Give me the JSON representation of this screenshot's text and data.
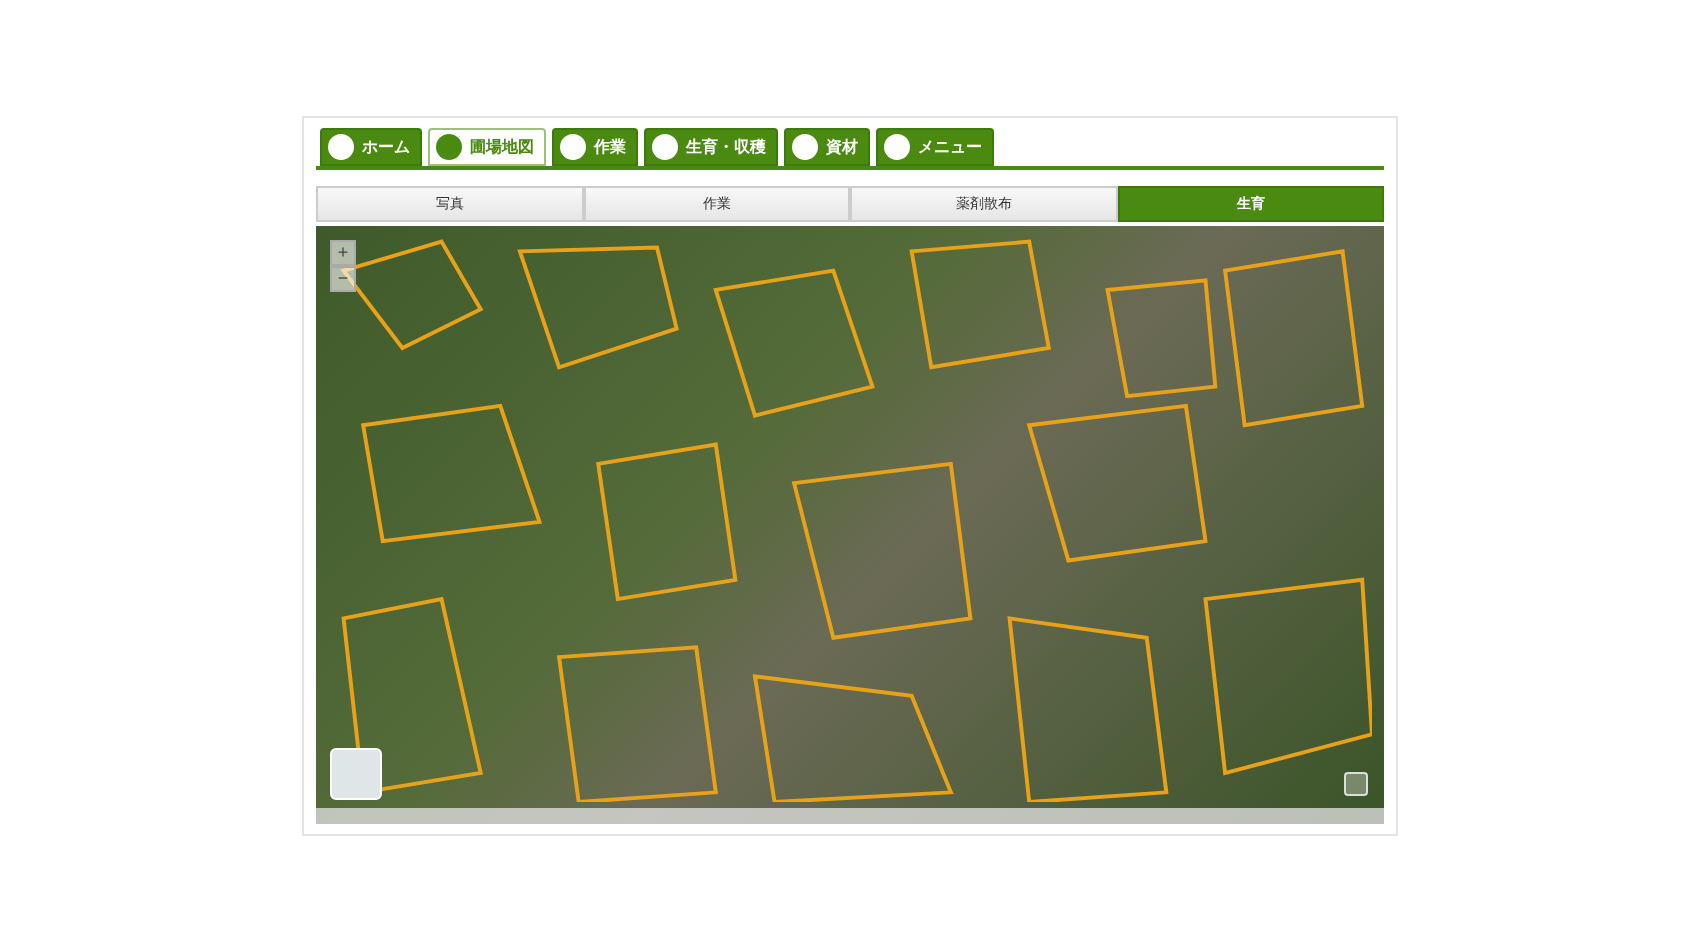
{
  "main_tabs": [
    {
      "label": "ホーム",
      "selected": false
    },
    {
      "label": "圃場地図",
      "selected": true
    },
    {
      "label": "作業",
      "selected": false
    },
    {
      "label": "生育・収穫",
      "selected": false
    },
    {
      "label": "資材",
      "selected": false
    },
    {
      "label": "メニュー",
      "selected": false
    }
  ],
  "sub_tabs": [
    {
      "label": "写真",
      "selected": false
    },
    {
      "label": "作業",
      "selected": false
    },
    {
      "label": "薬剤散布",
      "selected": false
    },
    {
      "label": "生育",
      "selected": true
    }
  ],
  "map": {
    "zoom_in": "+",
    "zoom_out": "−"
  }
}
